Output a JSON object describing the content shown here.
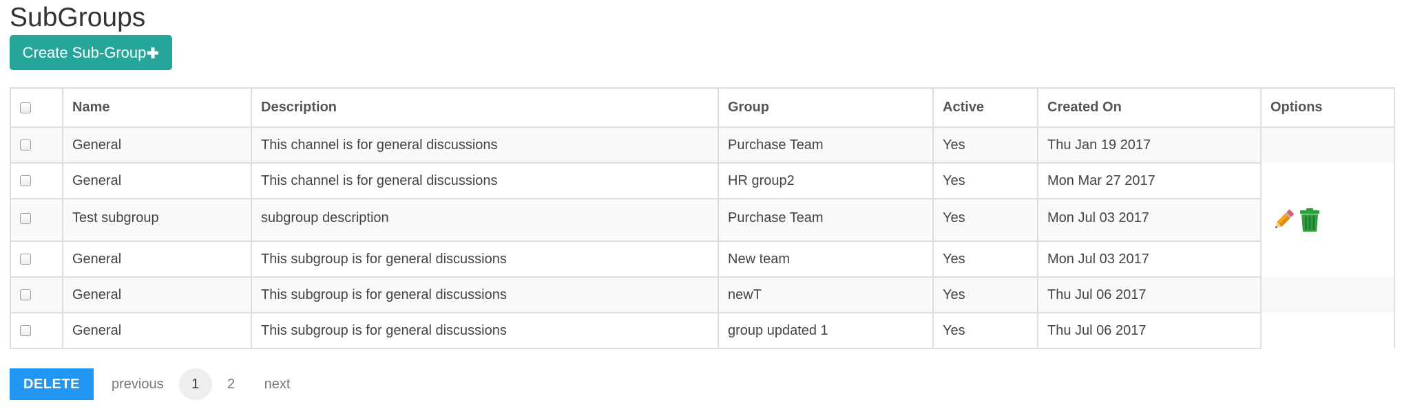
{
  "page": {
    "title": "SubGroups",
    "create_button_label": "Create Sub-Group",
    "create_button_icon": "plus-icon"
  },
  "table": {
    "columns": [
      "",
      "Name",
      "Description",
      "Group",
      "Active",
      "Created On",
      "Options"
    ],
    "rows": [
      {
        "name": "General",
        "description": "This channel is for general discussions",
        "group": "Purchase Team",
        "active": "Yes",
        "created_on": "Thu Jan 19 2017"
      },
      {
        "name": "General",
        "description": "This channel is for general discussions",
        "group": "HR group2",
        "active": "Yes",
        "created_on": "Mon Mar 27 2017"
      },
      {
        "name": "Test subgroup",
        "description": "subgroup description",
        "group": "Purchase Team",
        "active": "Yes",
        "created_on": "Mon Jul 03 2017"
      },
      {
        "name": "General",
        "description": "This subgroup is for general discussions",
        "group": "New team",
        "active": "Yes",
        "created_on": "Mon Jul 03 2017"
      },
      {
        "name": "General",
        "description": "This subgroup is for general discussions",
        "group": "newT",
        "active": "Yes",
        "created_on": "Thu Jul 06 2017"
      },
      {
        "name": "General",
        "description": "This subgroup is for general discussions",
        "group": "group updated 1",
        "active": "Yes",
        "created_on": "Thu Jul 06 2017"
      }
    ],
    "row_option_icons": [
      "pencil-icon",
      "trash-icon"
    ]
  },
  "pager": {
    "delete_label": "DELETE",
    "previous_label": "previous",
    "pages": [
      "1",
      "2"
    ],
    "current_page": "1",
    "next_label": "next"
  },
  "colors": {
    "create_button": "#26a69a",
    "delete_button": "#2196f3",
    "pencil": "#f5a623",
    "trash": "#2e9e3e",
    "border": "#dddddd",
    "stripe": "#f9f9f9"
  }
}
